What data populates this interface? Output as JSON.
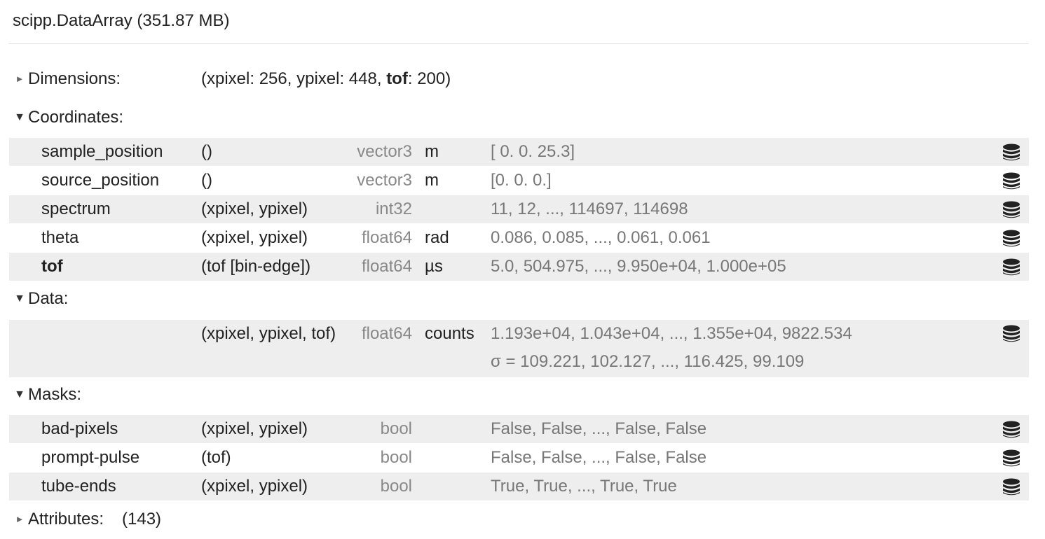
{
  "header": {
    "title": "scipp.DataArray (351.87 MB)"
  },
  "dimensions": {
    "label": "Dimensions:",
    "toggle_icon": "triangle-right-icon",
    "parts": [
      {
        "name": "xpixel",
        "value": "256",
        "bold": false
      },
      {
        "name": "ypixel",
        "value": "448",
        "bold": false
      },
      {
        "name": "tof",
        "value": "200",
        "bold": true
      }
    ]
  },
  "coordinates": {
    "label": "Coordinates:",
    "toggle_icon": "triangle-down-icon",
    "rows": [
      {
        "name": "sample_position",
        "dims": "()",
        "dtype": "vector3",
        "unit": "m",
        "values": "[ 0.  0. 25.3]",
        "bold": false
      },
      {
        "name": "source_position",
        "dims": "()",
        "dtype": "vector3",
        "unit": "m",
        "values": "[0. 0. 0.]",
        "bold": false
      },
      {
        "name": "spectrum",
        "dims": "(xpixel, ypixel)",
        "dtype": "int32",
        "unit": "",
        "values": "11, 12, ..., 114697, 114698",
        "bold": false
      },
      {
        "name": "theta",
        "dims": "(xpixel, ypixel)",
        "dtype": "float64",
        "unit": "rad",
        "values": "0.086, 0.085, ..., 0.061, 0.061",
        "bold": false
      },
      {
        "name": "tof",
        "dims": "(tof [bin-edge])",
        "dtype": "float64",
        "unit": "µs",
        "values": "5.0, 504.975, ..., 9.950e+04, 1.000e+05",
        "bold": true
      }
    ]
  },
  "data": {
    "label": "Data:",
    "toggle_icon": "triangle-down-icon",
    "dims": "(xpixel, ypixel, tof)",
    "dtype": "float64",
    "unit": "counts",
    "values": "1.193e+04, 1.043e+04, ..., 1.355e+04, 9822.534",
    "variances": "σ = 109.221, 102.127, ..., 116.425, 99.109"
  },
  "masks": {
    "label": "Masks:",
    "toggle_icon": "triangle-down-icon",
    "rows": [
      {
        "name": "bad-pixels",
        "dims": "(xpixel, ypixel)",
        "dtype": "bool",
        "unit": "",
        "values": "False, False, ..., False, False"
      },
      {
        "name": "prompt-pulse",
        "dims": "(tof)",
        "dtype": "bool",
        "unit": "",
        "values": "False, False, ..., False, False"
      },
      {
        "name": "tube-ends",
        "dims": "(xpixel, ypixel)",
        "dtype": "bool",
        "unit": "",
        "values": "True, True, ..., True, True"
      }
    ]
  },
  "attributes": {
    "label": "Attributes:",
    "count": "(143)",
    "toggle_icon": "triangle-right-icon"
  },
  "row_icon": "database-icon",
  "colors": {
    "shade": "#eeeeee",
    "dtype": "#888888",
    "values": "#777777"
  }
}
